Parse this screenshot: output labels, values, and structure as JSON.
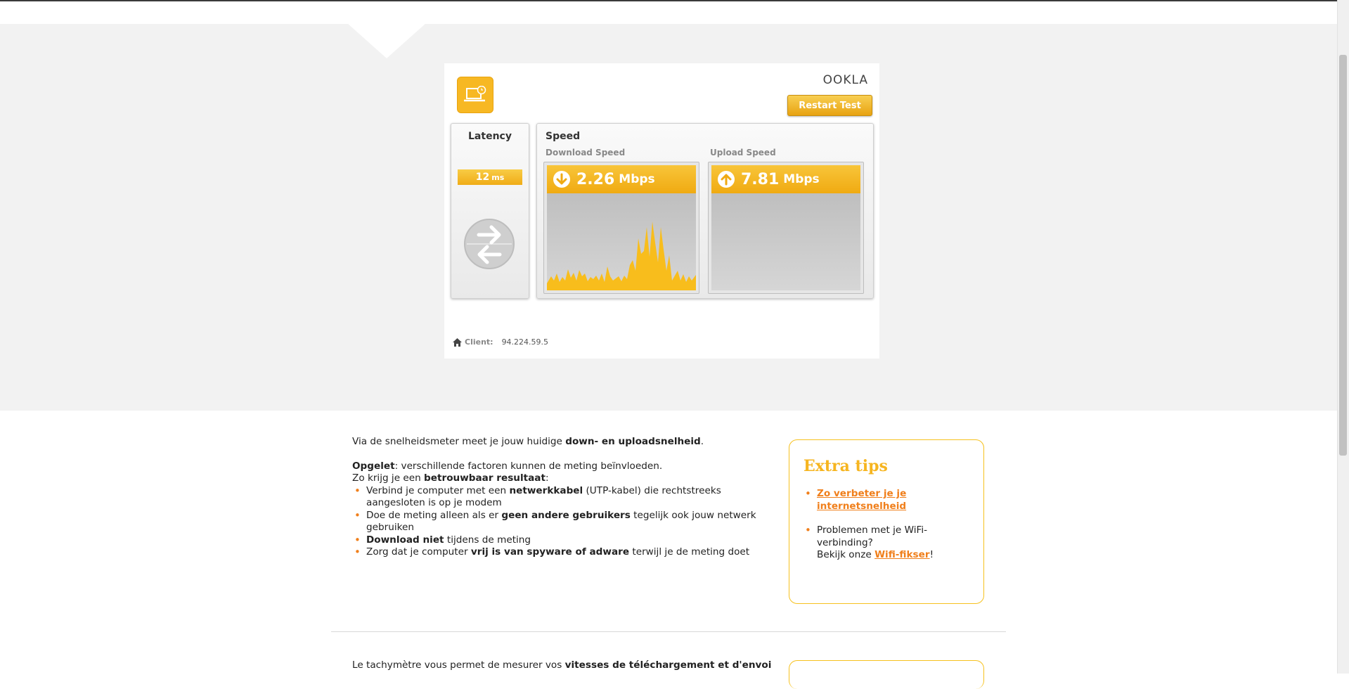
{
  "speedtest": {
    "brand": "OOKLA",
    "restart_label": "Restart Test",
    "latency": {
      "title": "Latency",
      "value": "12",
      "unit": "ms"
    },
    "speed": {
      "title": "Speed",
      "download": {
        "label": "Download Speed",
        "value": "2.26",
        "unit": "Mbps"
      },
      "upload": {
        "label": "Upload Speed",
        "value": "7.81",
        "unit": "Mbps"
      }
    },
    "client": {
      "label": "Client:",
      "ip": "94.224.59.5"
    }
  },
  "intro": {
    "line1_pre": "Via de snelheidsmeter meet je jouw huidige ",
    "line1_bold": "down- en uploadsnelheid",
    "line1_post": ".",
    "warn_bold": "Opgelet",
    "warn_text": ": verschillende factoren kunnen de meting beïnvloeden.",
    "line3_pre": "Zo krijg je een ",
    "line3_bold": "betrouwbaar resultaat",
    "line3_post": ":",
    "bullets": [
      {
        "pre": "Verbind je computer met een ",
        "bold": "netwerkkabel",
        "post": " (UTP-kabel) die rechtstreeks aangesloten is op je modem"
      },
      {
        "pre": "Doe de meting alleen als er ",
        "bold": "geen andere gebruikers",
        "post": " tegelijk ook jouw netwerk gebruiken"
      },
      {
        "pre": "",
        "bold": "Download niet",
        "post": " tijdens de meting"
      },
      {
        "pre": "Zorg dat je computer ",
        "bold": "vrij is van spyware of adware",
        "post": " terwijl je de meting doet"
      }
    ]
  },
  "tips": {
    "title": "Extra tips",
    "link1": "Zo verbeter je je internetsnelheid",
    "item2_text1": "Problemen met je WiFi-verbinding?",
    "item2_text2_pre": "Bekijk onze ",
    "item2_link": "Wifi-fikser",
    "item2_text2_post": "!"
  },
  "french": {
    "pre": "Le tachymètre vous permet de mesurer vos ",
    "bold": "vitesses de téléchargement et d'envoi"
  },
  "colors": {
    "accent": "#f6b520",
    "link": "#f07f1b"
  }
}
